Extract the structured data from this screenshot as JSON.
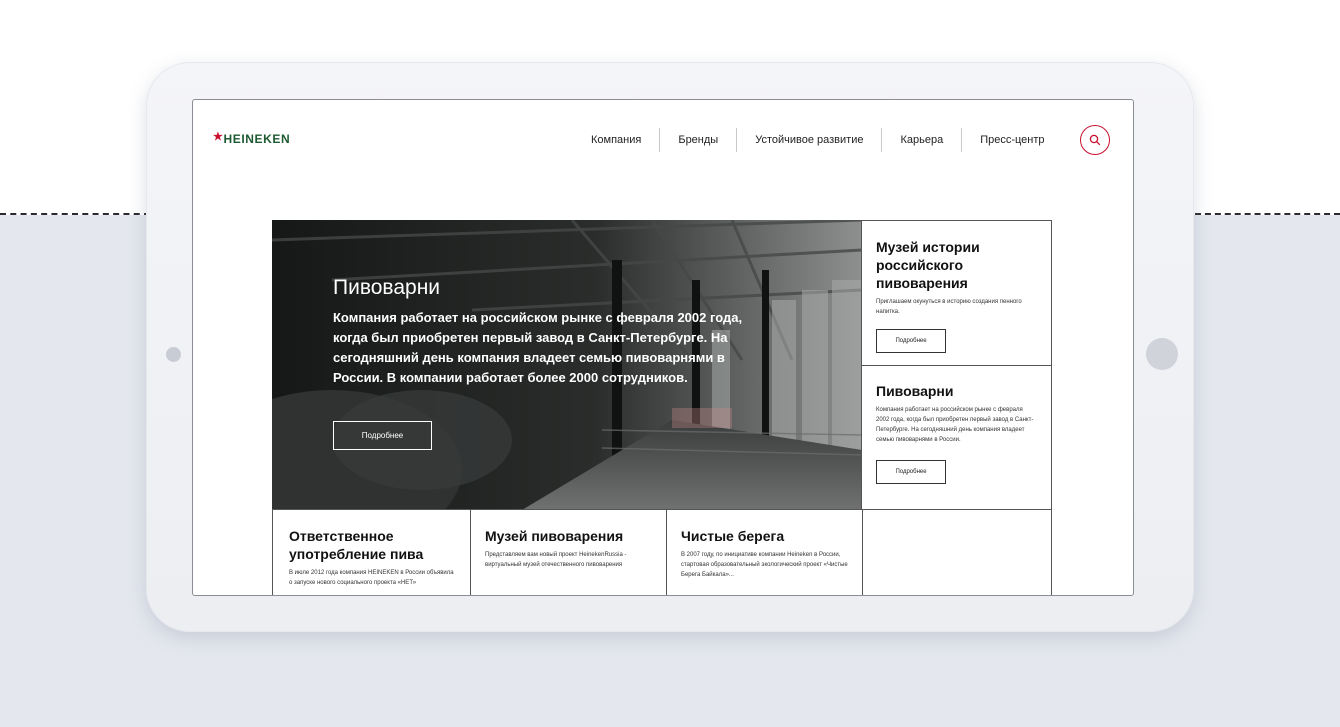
{
  "brand": {
    "logo_text": "HEINEKEN",
    "logo_star": "★",
    "accent": "#c8102e",
    "logo_color": "#1d5a32"
  },
  "nav": {
    "items": [
      {
        "label": "Компания"
      },
      {
        "label": "Бренды"
      },
      {
        "label": "Устойчивое развитие"
      },
      {
        "label": "Карьера"
      },
      {
        "label": "Пресс-центр"
      }
    ],
    "search_icon": "search-icon"
  },
  "hero": {
    "title": "Пивоварни",
    "text": "Компания работает на российском рынке с февраля 2002 года, когда был приобретен первый завод в Санкт-Петербурге. На сегодняшний день компания владеет семью пивоварнями в России. В компании работает более 2000 сотрудников.",
    "button": "Подробнее"
  },
  "side_cards": [
    {
      "title": "Музей истории российского пивоварения",
      "text": "Приглашаем окунуться в историю создания пенного напитка.",
      "button": "Подробнее"
    },
    {
      "title": "Пивоварни",
      "text": "Компания работает на российском рынке с февраля 2002 года, когда был приобретен первый завод в Санкт-Петербурге. На сегодняшний день компания владеет семью пивоварнями в России.",
      "button": "Подробнее"
    }
  ],
  "bottom_cards": [
    {
      "title": "Ответственное употребление пива",
      "text": "В июле 2012 года компания HEINEKEN в России объявила о запуске нового социального проекта «НЕТ»"
    },
    {
      "title": "Музей пивоварения",
      "text": "Представляем вам новый проект HeinekenRussia - виртуальный музей отечественного пивоварения"
    },
    {
      "title": "Чистые берега",
      "text": "В 2007 году, по инициативе компании Heineken в России, стартовая образовательный экологический проект «Чистые Берега Байкала»..."
    }
  ]
}
